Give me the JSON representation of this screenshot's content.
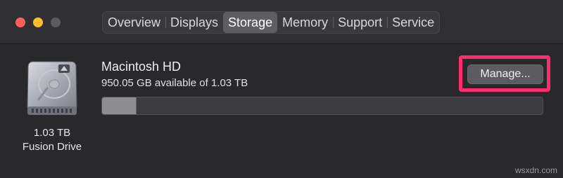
{
  "window": {
    "tabs": [
      {
        "label": "Overview",
        "active": false
      },
      {
        "label": "Displays",
        "active": false
      },
      {
        "label": "Storage",
        "active": true
      },
      {
        "label": "Memory",
        "active": false
      },
      {
        "label": "Support",
        "active": false
      },
      {
        "label": "Service",
        "active": false
      }
    ]
  },
  "disk": {
    "icon": "hard-drive-icon",
    "capacity": "1.03 TB",
    "type": "Fusion Drive"
  },
  "volume": {
    "name": "Macintosh HD",
    "availability": "950.05 GB available of 1.03 TB",
    "used_fraction": 0.077,
    "manage_label": "Manage..."
  },
  "colors": {
    "highlight": "#ff2d6f",
    "close": "#ff5f57",
    "minimize": "#febc2e"
  },
  "watermark": "wsxdn.com"
}
